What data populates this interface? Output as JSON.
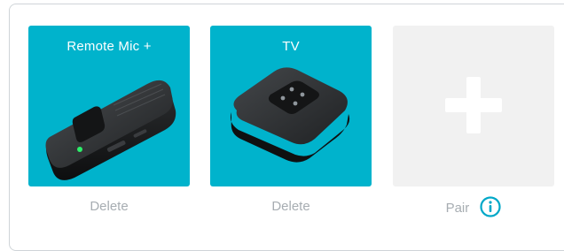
{
  "devices": [
    {
      "name": "Remote Mic +",
      "action_label": "Delete",
      "icon": "remote-mic-device-icon"
    },
    {
      "name": "TV",
      "action_label": "Delete",
      "icon": "tv-connector-device-icon"
    }
  ],
  "pair_tile": {
    "icon": "plus-icon",
    "action_label": "Pair",
    "info_icon": "info-icon"
  },
  "colors": {
    "device_tile": "#00b3cc",
    "pair_tile": "#f1f1f1",
    "action_text": "#a7adb2",
    "info_accent": "#00a8c8"
  }
}
